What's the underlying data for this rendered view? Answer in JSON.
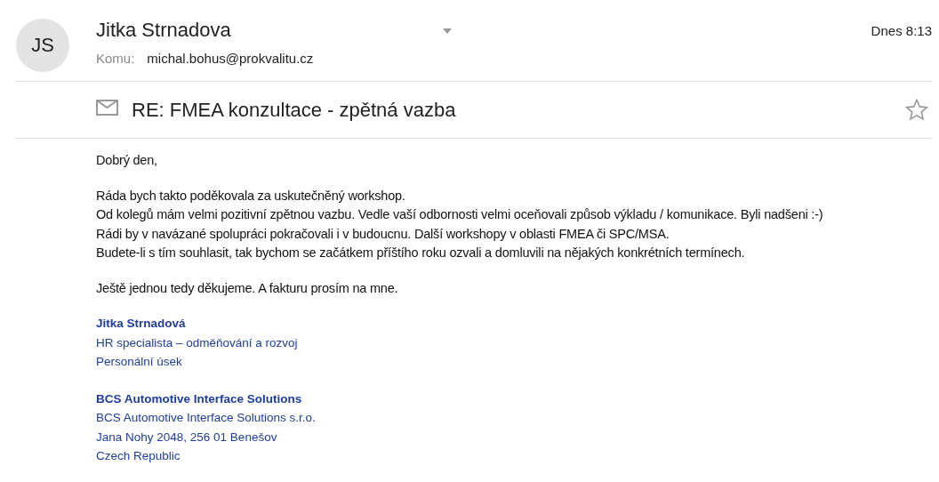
{
  "sender": {
    "initials": "JS",
    "name": "Jitka Strnadova"
  },
  "to_label": "Komu:",
  "to": "michal.bohus@prokvalitu.cz",
  "time": "Dnes 8:13",
  "subject": "RE: FMEA konzultace - zpětná vazba",
  "starred": false,
  "body": [
    [
      "Dobrý den,"
    ],
    [
      "Ráda bych takto poděkovala za uskutečněný workshop.",
      "Od kolegů mám velmi pozitivní zpětnou vazbu. Vedle vaší odbornosti velmi oceňovali způsob výkladu / komunikace. Byli nadšeni :-)",
      "Rádi by v navázané spolupráci pokračovali i v budoucnu. Další workshopy v oblasti FMEA či SPC/MSA.",
      "Budete-li s tím souhlasit, tak bychom se začátkem příštího roku ozvali a domluvili na nějakých konkrétních termínech."
    ],
    [
      "Ještě jednou tedy děkujeme. A fakturu prosím na mne."
    ]
  ],
  "signature": [
    [
      {
        "text": "Jitka Strnadová",
        "kind": "bold"
      },
      {
        "text": "HR specialista – odměňování a rozvoj",
        "kind": "plain"
      },
      {
        "text": "Personální úsek",
        "kind": "plain"
      }
    ],
    [
      {
        "text": "BCS Automotive Interface Solutions",
        "kind": "bold"
      },
      {
        "text": "BCS Automotive Interface Solutions s.r.o.",
        "kind": "plain"
      },
      {
        "text": "Jana Nohy 2048, 256 01 Benešov",
        "kind": "plain"
      },
      {
        "text": "Czech Republic",
        "kind": "plain"
      }
    ]
  ]
}
